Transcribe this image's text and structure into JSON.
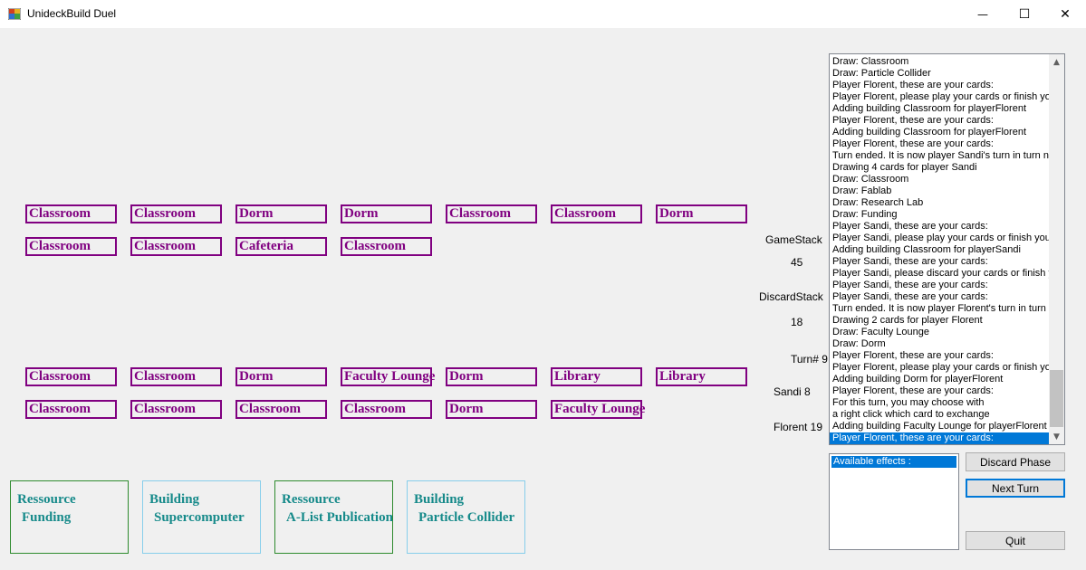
{
  "window": {
    "title": "UnideckBuild Duel",
    "icon": "app-icon",
    "minimize_glyph": "—",
    "maximize_glyph": "☐",
    "close_glyph": "✕"
  },
  "board": {
    "top_rows": [
      [
        "Classroom",
        "Classroom",
        "Dorm",
        "Dorm",
        "Classroom",
        "Classroom",
        "Dorm"
      ],
      [
        "Classroom",
        "Classroom",
        "Cafeteria",
        "Classroom"
      ]
    ],
    "bottom_rows": [
      [
        "Classroom",
        "Classroom",
        "Dorm",
        "Faculty Lounge",
        "Dorm",
        "Library",
        "Library"
      ],
      [
        "Classroom",
        "Classroom",
        "Classroom",
        "Classroom",
        "Dorm",
        "Faculty Lounge"
      ]
    ]
  },
  "status": {
    "gamestack_label": "GameStack",
    "gamestack_value": "45",
    "discardstack_label": "DiscardStack",
    "discardstack_value": "18",
    "turn_label": "Turn# 9",
    "player1_score": "Sandi 8",
    "player2_score": "Florent 19"
  },
  "log": {
    "lines": [
      "Draw: Classroom",
      "Draw: Particle Collider",
      "Player Florent, these are your cards:",
      "Player Florent, please play your cards or finish your",
      "Adding building Classroom for playerFlorent",
      "Player Florent, these are your cards:",
      "Adding building Classroom for playerFlorent",
      "Player Florent, these are your cards:",
      "Turn ended. It is now player Sandi's turn in turn nu",
      "Drawing 4 cards for player Sandi",
      "Draw: Classroom",
      "Draw: Fablab",
      "Draw: Research Lab",
      "Draw: Funding",
      "Player Sandi, these are your cards:",
      "Player Sandi, please play your cards or finish your t",
      "Adding building Classroom for playerSandi",
      "Player Sandi, these are your cards:",
      "Player Sandi, please discard your cards or finish yo",
      "Player Sandi, these are your cards:",
      "Player Sandi, these are your cards:",
      "Turn ended. It is now player Florent's turn in turn nu",
      "Drawing 2 cards for player Florent",
      "Draw: Faculty Lounge",
      "Draw: Dorm",
      "Player Florent, these are your cards:",
      "Player Florent, please play your cards or finish your",
      "Adding building Dorm for playerFlorent",
      "Player Florent, these are your cards:",
      "For this turn, you may choose with",
      " a right click which card to exchange",
      "Adding building Faculty Lounge for playerFlorent",
      "Player Florent, these are your cards:"
    ],
    "selected_index": 32,
    "scroll_up_glyph": "▲",
    "scroll_down_glyph": "▼"
  },
  "effects": {
    "header": "Available effects :"
  },
  "buttons": {
    "discard_phase": "Discard Phase",
    "next_turn": "Next Turn",
    "quit": "Quit"
  },
  "hand": [
    {
      "kind": "Ressource",
      "name": "Funding"
    },
    {
      "kind": "Building",
      "name": "Supercomputer"
    },
    {
      "kind": "Ressource",
      "name": "A-List Publication"
    },
    {
      "kind": "Building",
      "name": "Particle Collider"
    }
  ],
  "colors": {
    "card_border": "#800080",
    "hand_text": "#168a8a",
    "ressource_border": "#2e8b2e",
    "building_border": "#87ceeb",
    "selection": "#0078d7"
  }
}
